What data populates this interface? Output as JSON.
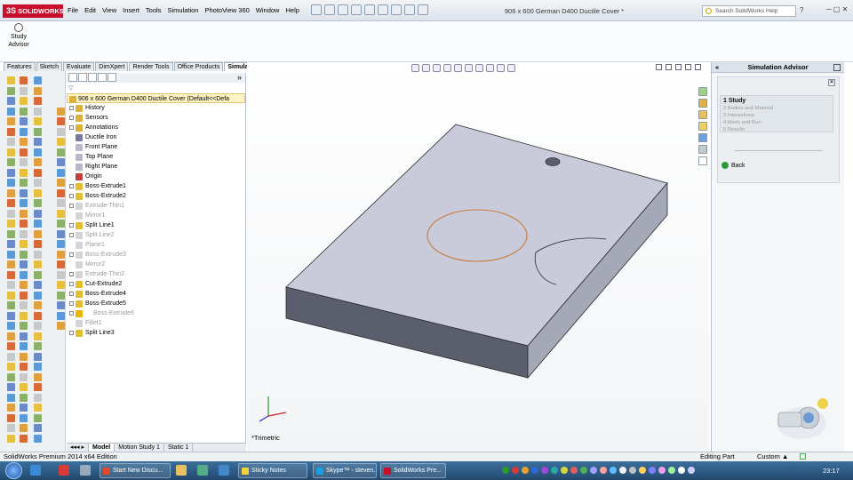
{
  "app": {
    "brand": "SOLIDWORKS",
    "brand_prefix": "3S",
    "document_title": "906 x 600 German D400 Ductile Cover *"
  },
  "menu": [
    "File",
    "Edit",
    "View",
    "Insert",
    "Tools",
    "Simulation",
    "PhotoView 360",
    "Window",
    "Help"
  ],
  "search": {
    "placeholder": "Search SolidWorks Help"
  },
  "help_label": "?",
  "ribbon": {
    "study_advisor_label": "Study Advisor"
  },
  "command_tabs": [
    {
      "label": "Features",
      "active": false
    },
    {
      "label": "Sketch",
      "active": false
    },
    {
      "label": "Evaluate",
      "active": false
    },
    {
      "label": "DimXpert",
      "active": false
    },
    {
      "label": "Render Tools",
      "active": false
    },
    {
      "label": "Office Products",
      "active": false
    },
    {
      "label": "Simulation",
      "active": true
    }
  ],
  "tree": {
    "filter_glyph": "▽",
    "expand_glyph": "»",
    "root": "906 x 600 German D400 Ductile Cover  (Default<<Defa",
    "items": [
      {
        "label": "History",
        "state": "normal",
        "expandable": true,
        "icon": "folder-icon"
      },
      {
        "label": "Sensors",
        "state": "normal",
        "expandable": true,
        "icon": "sensor-icon"
      },
      {
        "label": "Annotations",
        "state": "normal",
        "expandable": true,
        "icon": "annotation-icon"
      },
      {
        "label": "Ductile Iron",
        "state": "normal",
        "expandable": false,
        "icon": "material-icon"
      },
      {
        "label": "Front Plane",
        "state": "normal",
        "expandable": false,
        "icon": "plane-icon"
      },
      {
        "label": "Top Plane",
        "state": "normal",
        "expandable": false,
        "icon": "plane-icon"
      },
      {
        "label": "Right Plane",
        "state": "normal",
        "expandable": false,
        "icon": "plane-icon"
      },
      {
        "label": "Origin",
        "state": "normal",
        "expandable": false,
        "icon": "origin-icon"
      },
      {
        "label": "Boss-Extrude1",
        "state": "normal",
        "expandable": true,
        "icon": "extrude-icon"
      },
      {
        "label": "Boss-Extrude2",
        "state": "normal",
        "expandable": true,
        "icon": "extrude-icon"
      },
      {
        "label": "Extrude-Thin1",
        "state": "suppressed",
        "expandable": true,
        "icon": "extrude-icon"
      },
      {
        "label": "Mirror1",
        "state": "suppressed",
        "expandable": false,
        "icon": "mirror-icon"
      },
      {
        "label": "Split Line1",
        "state": "normal",
        "expandable": true,
        "icon": "split-line-icon"
      },
      {
        "label": "Split Line2",
        "state": "suppressed",
        "expandable": true,
        "icon": "split-line-icon"
      },
      {
        "label": "Plane1",
        "state": "suppressed",
        "expandable": false,
        "icon": "plane-icon"
      },
      {
        "label": "Boss-Extrude3",
        "state": "suppressed",
        "expandable": true,
        "icon": "extrude-icon"
      },
      {
        "label": "Mirror2",
        "state": "suppressed",
        "expandable": false,
        "icon": "mirror-icon"
      },
      {
        "label": "Extrude-Thin2",
        "state": "suppressed",
        "expandable": true,
        "icon": "extrude-icon"
      },
      {
        "label": "Cut-Extrude2",
        "state": "normal",
        "expandable": true,
        "icon": "cut-icon"
      },
      {
        "label": "Boss-Extrude4",
        "state": "normal",
        "expandable": true,
        "icon": "extrude-icon"
      },
      {
        "label": "Boss-Extrude5",
        "state": "normal",
        "expandable": true,
        "icon": "extrude-icon"
      },
      {
        "label": "Boss-Extrude6",
        "state": "warning",
        "expandable": true,
        "icon": "warning-icon"
      },
      {
        "label": "Fillet1",
        "state": "suppressed",
        "expandable": false,
        "icon": "fillet-icon"
      },
      {
        "label": "Split Line3",
        "state": "normal",
        "expandable": true,
        "icon": "split-line-icon"
      }
    ]
  },
  "bottom_tabs": [
    {
      "label": "Model",
      "active": true
    },
    {
      "label": "Motion Study 1",
      "active": false
    },
    {
      "label": "Static 1",
      "active": false
    }
  ],
  "viewport": {
    "view_label": "*Trimetric",
    "part_color": "#c8cad8",
    "edge_color": "#2a2a2a",
    "split_line_color": "#c77a3a"
  },
  "advisor": {
    "title": "Simulation Advisor",
    "collapse_glyph": "«",
    "steps": [
      {
        "label": "1 Study",
        "current": true
      },
      {
        "label": "2 Bodies and Material",
        "current": false
      },
      {
        "label": "3 Interactions",
        "current": false
      },
      {
        "label": "4 Mesh and Run",
        "current": false
      },
      {
        "label": "5 Results",
        "current": false
      }
    ],
    "back_label": "Back"
  },
  "status": {
    "product": "SolidWorks Premium 2014 x64 Edition",
    "mode": "Editing Part",
    "units": "Custom",
    "units_caret": "▲"
  },
  "taskbar": {
    "buttons": [
      {
        "label": "Start New Discu...",
        "color": "#e04a2a"
      },
      {
        "label": "Sticky Notes",
        "color": "#f2d23c"
      },
      {
        "label": "Skype™ - steven...",
        "color": "#1aa0e0"
      },
      {
        "label": "SolidWorks Pre...",
        "color": "#c8102e"
      }
    ],
    "clock": "23:17"
  }
}
